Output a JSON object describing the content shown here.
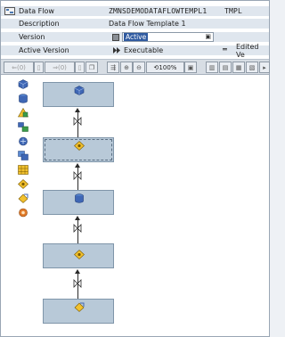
{
  "header": {
    "data_flow_label": "Data Flow",
    "data_flow_value": "ZMNSDEMODATAFLOWTEMPL1",
    "data_flow_suffix": "TMPL",
    "description_label": "Description",
    "description_value": "Data Flow Template 1",
    "version_label": "Version",
    "version_value": "Active",
    "active_version_label": "Active Version",
    "active_version_value": "Executable",
    "edited_version_value": "Edited Ve"
  },
  "toolbar": {
    "back_count": "(0)",
    "forward_count": "(0)",
    "zoom_value": "100%"
  },
  "palette": {
    "items": [
      "infoprovider-icon",
      "datasource-icon",
      "transformation-icon",
      "dtp-icon",
      "infosource-icon",
      "multiprovider-icon",
      "infocube-icon",
      "dso-icon",
      "infopackage-icon",
      "process-chain-icon"
    ]
  },
  "canvas": {
    "nodes": [
      "infocube-node",
      "dso-node",
      "datasource-node",
      "dso-node",
      "infopackage-node"
    ]
  },
  "colors": {
    "accent": "#b8c9d8",
    "header_bg": "#dfe6ee",
    "toolbar_bg": "#d7dde4"
  }
}
